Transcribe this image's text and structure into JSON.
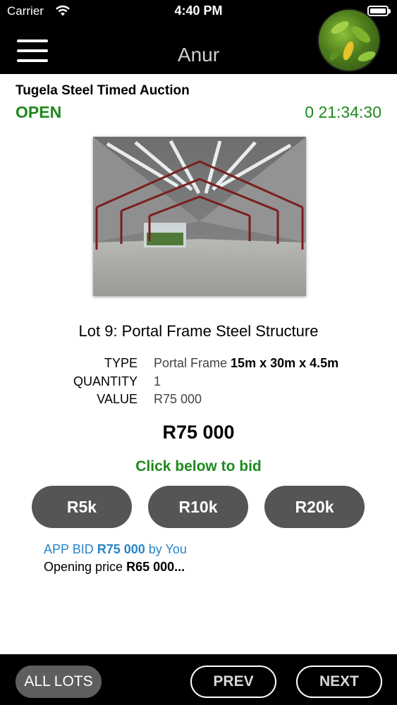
{
  "status_bar": {
    "carrier": "Carrier",
    "time": "4:40 PM"
  },
  "header": {
    "title": "Anur"
  },
  "auction": {
    "name": "Tugela Steel Timed Auction",
    "status": "OPEN",
    "countdown": "0 21:34:30"
  },
  "lot": {
    "title": "Lot 9: Portal Frame Steel Structure",
    "specs": [
      {
        "key": "TYPE",
        "value": "Portal Frame",
        "value_bold": "15m x 30m x 4.5m"
      },
      {
        "key": "QUANTITY",
        "value": "1",
        "value_bold": ""
      },
      {
        "key": "VALUE",
        "value": "R75 000",
        "value_bold": ""
      }
    ],
    "current_price": "R75 000"
  },
  "bidding": {
    "prompt": "Click below to bid",
    "buttons": [
      "R5k",
      "R10k",
      "R20k"
    ],
    "last_bid": {
      "prefix": "APP BID",
      "amount": "R75 000",
      "suffix": "by You"
    },
    "opening": {
      "label": "Opening price",
      "amount": "R65 000..."
    }
  },
  "footer": {
    "all_lots": "ALL LOTS",
    "prev": "PREV",
    "next": "NEXT"
  },
  "colors": {
    "green": "#1d8a1d",
    "blue": "#2a85c9",
    "button_gray": "#555555"
  },
  "icons": [
    "hamburger-menu-icon",
    "wifi-icon",
    "battery-icon"
  ]
}
